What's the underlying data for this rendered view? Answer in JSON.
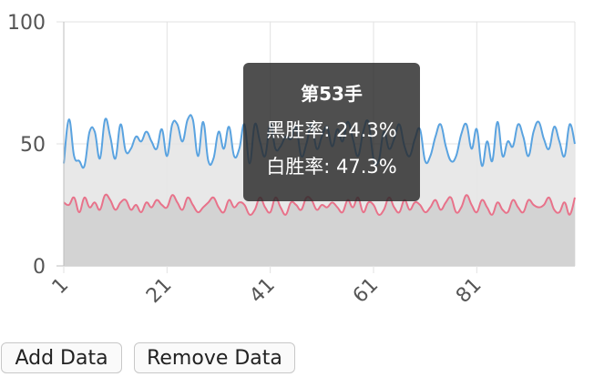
{
  "chart_data": {
    "type": "area",
    "y_ticks": [
      0,
      50,
      100
    ],
    "x_tick_labels": [
      "1",
      "21",
      "41",
      "61",
      "81"
    ],
    "ylim": [
      0,
      100
    ],
    "grid": true,
    "series": [
      {
        "color": "#5aa3e0",
        "fill": "#e6e6e6",
        "values": [
          42,
          60,
          45,
          43,
          41,
          55,
          55,
          44,
          60,
          53,
          44,
          58,
          47,
          48,
          53,
          51,
          55,
          51,
          48,
          56,
          45,
          58,
          58,
          51,
          60,
          60,
          45,
          59,
          43,
          44,
          55,
          48,
          57,
          45,
          48,
          58,
          42,
          58,
          51,
          45,
          58,
          48,
          49,
          53,
          52,
          57,
          45,
          50,
          58,
          48,
          53,
          57,
          49,
          56,
          51,
          59,
          52,
          45,
          55,
          59,
          44,
          43,
          55,
          48,
          52,
          58,
          49,
          45,
          52,
          56,
          43,
          45,
          53,
          58,
          49,
          43,
          45,
          54,
          58,
          48,
          56,
          41,
          51,
          43,
          59,
          45,
          51,
          49,
          58,
          53,
          45,
          55,
          59,
          52,
          48,
          57,
          51,
          45,
          58,
          50
        ]
      },
      {
        "color": "#e8728a",
        "fill": "#d0d0d0",
        "values": [
          26,
          25,
          28,
          22,
          28,
          24,
          26,
          23,
          29,
          27,
          23,
          26,
          27,
          23,
          25,
          22,
          26,
          24,
          27,
          25,
          24,
          29,
          26,
          23,
          28,
          25,
          22,
          24,
          26,
          28,
          24,
          22,
          27,
          24,
          26,
          25,
          21,
          23,
          28,
          24,
          22,
          28,
          24,
          21,
          26,
          25,
          23,
          28,
          27,
          23,
          25,
          24,
          26,
          24,
          22,
          27,
          24,
          28,
          22,
          26,
          25,
          21,
          23,
          28,
          24,
          22,
          27,
          23,
          26,
          25,
          22,
          24,
          27,
          23,
          26,
          28,
          22,
          24,
          29,
          25,
          22,
          27,
          24,
          21,
          26,
          23,
          22,
          27,
          24,
          22,
          27,
          25,
          24,
          25,
          28,
          23,
          22,
          26,
          21,
          28
        ]
      }
    ]
  },
  "tooltip": {
    "title": "第53手",
    "line1": "黑胜率: 24.3%",
    "line2": "白胜率: 47.3%"
  },
  "buttons": {
    "add": "Add Data",
    "remove": "Remove Data"
  }
}
